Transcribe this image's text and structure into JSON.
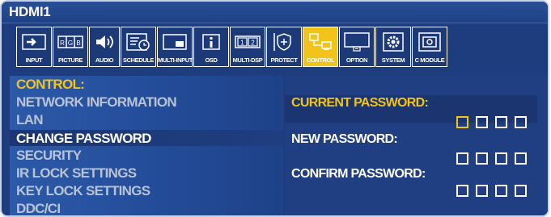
{
  "window": {
    "title": "HDMI1"
  },
  "toolbar": {
    "items": [
      {
        "label": "INPUT",
        "icon": "input-icon",
        "active": false
      },
      {
        "label": "PICTURE",
        "icon": "rgb-icon",
        "active": false
      },
      {
        "label": "AUDIO",
        "icon": "speaker-icon",
        "active": false
      },
      {
        "label": "SCHEDULE",
        "icon": "schedule-icon",
        "active": false
      },
      {
        "label": "MULTI-INPUT",
        "icon": "multi-input-icon",
        "active": false
      },
      {
        "label": "OSD",
        "icon": "info-icon",
        "active": false
      },
      {
        "label": "MULTI-DSP",
        "icon": "multi-display-icon",
        "active": false
      },
      {
        "label": "PROTECT",
        "icon": "shield-icon",
        "active": false
      },
      {
        "label": "CONTROL",
        "icon": "control-icon",
        "active": true
      },
      {
        "label": "OPTION",
        "icon": "monitor-icon",
        "active": false
      },
      {
        "label": "SYSTEM",
        "icon": "gear-icon",
        "active": false
      },
      {
        "label": "C MODULE",
        "icon": "module-icon",
        "active": false
      }
    ]
  },
  "menu": {
    "heading": "CONTROL:",
    "items": [
      "NETWORK INFORMATION",
      "LAN",
      "CHANGE PASSWORD",
      "SECURITY",
      "IR LOCK SETTINGS",
      "KEY LOCK SETTINGS",
      "DDC/CI"
    ],
    "selected": "CHANGE PASSWORD"
  },
  "password": {
    "current_label": "CURRENT PASSWORD:",
    "new_label": "NEW PASSWORD:",
    "confirm_label": "CONFIRM PASSWORD:"
  },
  "colors": {
    "background": "#1e3d7e",
    "accent": "#f2c41b",
    "text": "#ffffff",
    "dim_text": "#b9c3d6"
  }
}
